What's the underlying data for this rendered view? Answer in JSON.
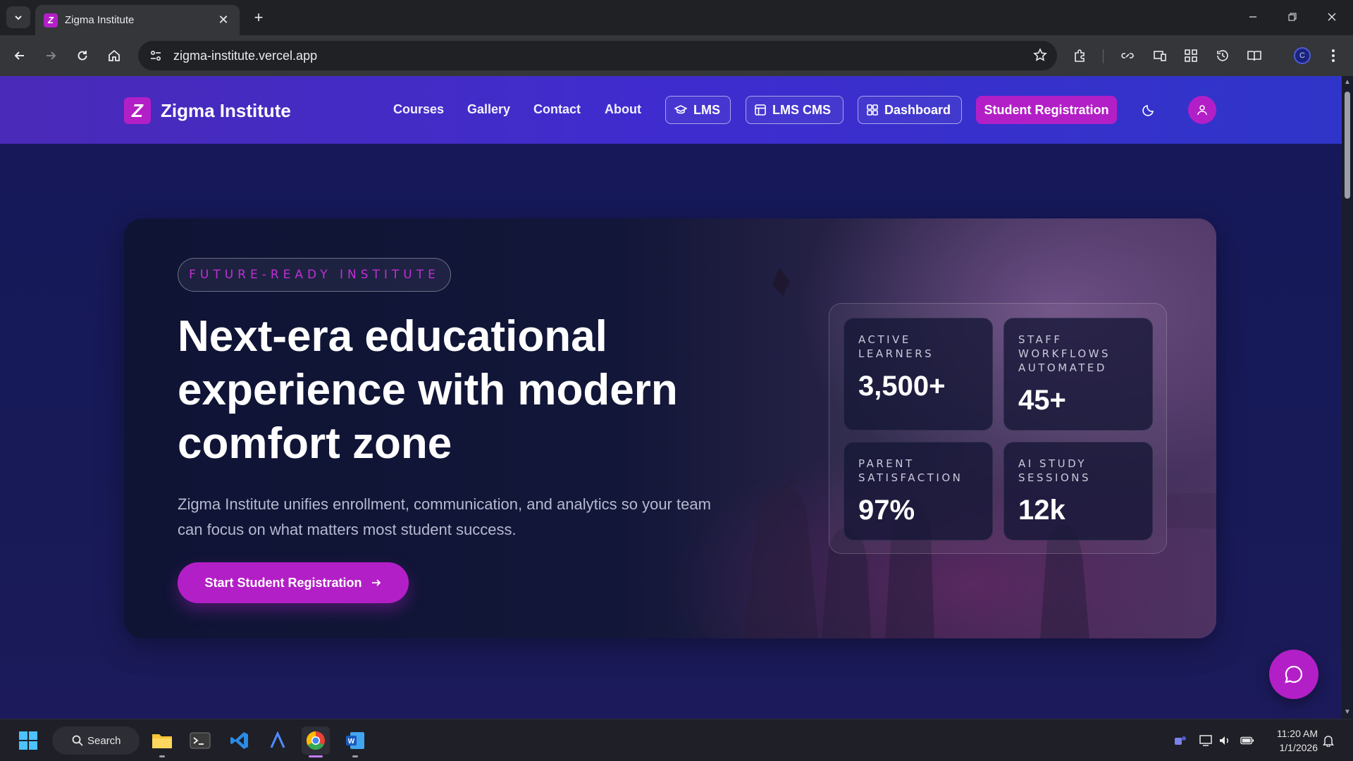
{
  "browser": {
    "tab_title": "Zigma Institute",
    "url": "zigma-institute.vercel.app"
  },
  "site": {
    "logo_glyph": "Z",
    "name": "Zigma Institute",
    "nav": [
      "Courses",
      "Gallery",
      "Contact",
      "About"
    ],
    "pills": [
      {
        "label": "LMS",
        "icon": "graduation-cap-icon"
      },
      {
        "label": "LMS CMS",
        "icon": "layout-icon"
      },
      {
        "label": "Dashboard",
        "icon": "grid-icon"
      }
    ],
    "register_label": "Student Registration",
    "theme_icon": "moon-icon",
    "user_icon": "user-icon"
  },
  "hero": {
    "badge": "FUTURE-READY INSTITUTE",
    "title_lines": [
      "Next-era educational",
      "experience with modern",
      "comfort zone"
    ],
    "subtitle_lines": [
      "Zigma Institute unifies enrollment, communication, and analytics so your team",
      "can focus on what matters most student success."
    ],
    "cta_label": "Start Student Registration"
  },
  "stats": [
    {
      "label_lines": [
        "ACTIVE",
        "LEARNERS"
      ],
      "value": "3,500+"
    },
    {
      "label_lines": [
        "STAFF",
        "WORKFLOWS",
        "AUTOMATED"
      ],
      "value": "45+"
    },
    {
      "label_lines": [
        "PARENT",
        "SATISFACTION"
      ],
      "value": "97%"
    },
    {
      "label_lines": [
        "AI STUDY",
        "SESSIONS"
      ],
      "value": "12k"
    }
  ],
  "taskbar": {
    "search_label": "Search",
    "time": "11:20 AM",
    "date": "1/1/2026"
  },
  "colors": {
    "accent": "#b31fc6",
    "header": "#4a2ab8",
    "page_bg": "#16185a"
  }
}
